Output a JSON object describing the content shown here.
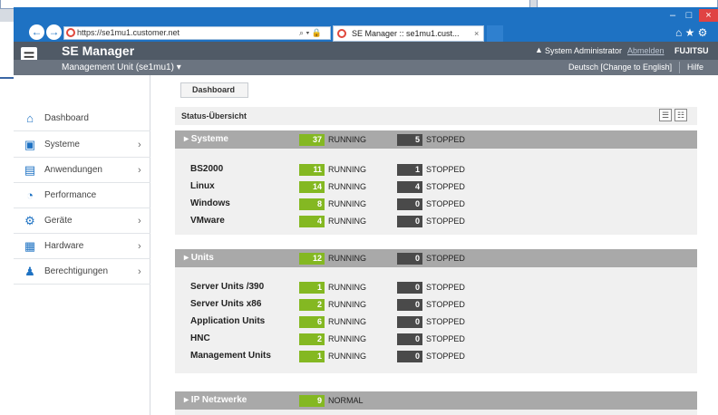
{
  "browser": {
    "url": "https://se1mu1.customer.net",
    "address_tools": "⌕ ▾ 🔒 ↻",
    "tab_title": "SE Manager :: se1mu1.cust...",
    "tab_close": "×",
    "window_controls": {
      "minimize": "–",
      "maximize": "□",
      "close": "×"
    },
    "toolbar_icons": "⌂ ★ ⚙",
    "back_icon": "←",
    "forward_icon": "→"
  },
  "app": {
    "title": "SE Manager",
    "menu_icon": "☰",
    "user_icon": "▲",
    "user": "System Administrator",
    "logout": "Abmelden",
    "brand": "FUJITSU",
    "management_unit": "Management Unit (se1mu1) ▾",
    "language": "Deutsch [Change to English]",
    "help": "Hilfe"
  },
  "sidebar": {
    "items": [
      {
        "label": "Dashboard",
        "icon": "home-icon",
        "glyph": "⌂",
        "has_children": false
      },
      {
        "label": "Systeme",
        "icon": "systems-icon",
        "glyph": "▣",
        "has_children": true
      },
      {
        "label": "Anwendungen",
        "icon": "applications-icon",
        "glyph": "▤",
        "has_children": true
      },
      {
        "label": "Performance",
        "icon": "gauge-icon",
        "glyph": "◔",
        "has_children": false
      },
      {
        "label": "Geräte",
        "icon": "gear-icon",
        "glyph": "⚙",
        "has_children": true
      },
      {
        "label": "Hardware",
        "icon": "chip-icon",
        "glyph": "▦",
        "has_children": true
      },
      {
        "label": "Berechtigungen",
        "icon": "users-icon",
        "glyph": "♟",
        "has_children": true
      }
    ],
    "chevron": "›"
  },
  "main": {
    "breadcrumb": "Dashboard",
    "status_title": "Status-Übersicht",
    "view_list_icon": "☰",
    "view_grid_icon": "☷",
    "groups": [
      {
        "title": "▸ Systeme",
        "running": "37",
        "running_label": "RUNNING",
        "stopped": "5",
        "stopped_label": "STOPPED",
        "rows": [
          {
            "label": "BS2000",
            "running": "11",
            "stopped": "1"
          },
          {
            "label": "Linux",
            "running": "14",
            "stopped": "4"
          },
          {
            "label": "Windows",
            "running": "8",
            "stopped": "0"
          },
          {
            "label": "VMware",
            "running": "4",
            "stopped": "0"
          }
        ]
      },
      {
        "title": "▸ Units",
        "running": "12",
        "running_label": "RUNNING",
        "stopped": "0",
        "stopped_label": "STOPPED",
        "rows": [
          {
            "label": "Server Units /390",
            "running": "1",
            "stopped": "0"
          },
          {
            "label": "Server Units x86",
            "running": "2",
            "stopped": "0"
          },
          {
            "label": "Application Units",
            "running": "6",
            "stopped": "0"
          },
          {
            "label": "HNC",
            "running": "2",
            "stopped": "0"
          },
          {
            "label": "Management Units",
            "running": "1",
            "stopped": "0"
          }
        ]
      },
      {
        "title": "▸ IP Netzwerke",
        "running": "9",
        "running_label": "NORMAL"
      }
    ],
    "row_running_label": "RUNNING",
    "row_stopped_label": "STOPPED"
  },
  "colors": {
    "accent": "#1e72c3",
    "running": "#84b822",
    "stopped": "#4a4a4a",
    "header": "#505a66"
  }
}
